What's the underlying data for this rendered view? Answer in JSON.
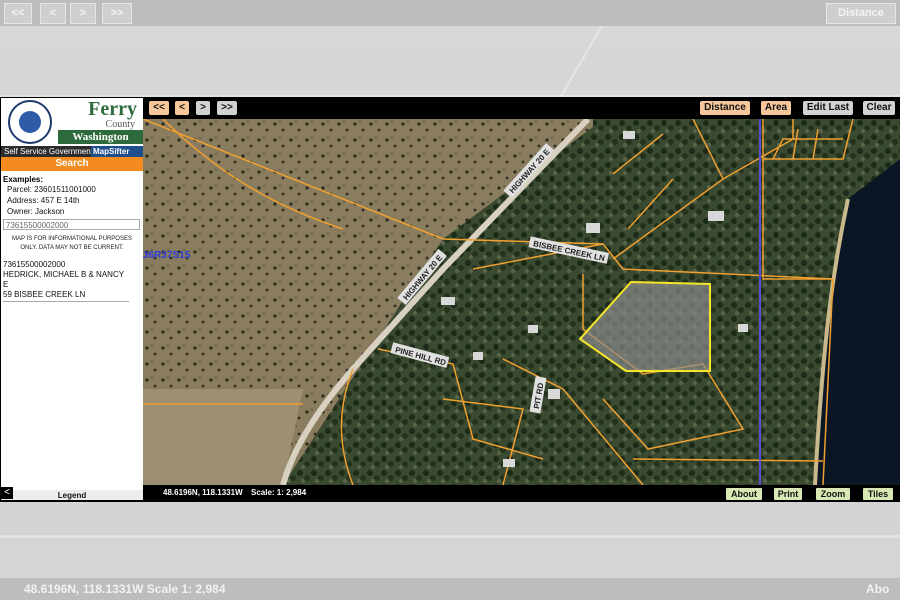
{
  "background": {
    "nav_buttons": [
      "<<",
      "<",
      ">",
      ">>"
    ],
    "distance_label": "Distance",
    "status_text": "48.6196N, 118.1331W    Scale  1: 2,984",
    "about_label": "Abo"
  },
  "sidebar": {
    "county": "Ferry",
    "county_sub": "County",
    "state": "Washington",
    "seal_text": "FERRY COUNTY",
    "brand_left": "Self Service Government",
    "brand_right": "MapSifter",
    "search_label": "Search",
    "examples_title": "Examples:",
    "examples": [
      "Parcel: 23601511001000",
      "Address: 457 E 14th",
      "Owner: Jackson"
    ],
    "search_value": "73615500002000",
    "disclaimer": "MAP IS FOR INFORMATIONAL PURPOSES ONLY. DATA MAY NOT BE CURRENT.",
    "result": {
      "parcel": "73615500002000",
      "owner": "HEDRICK, MICHAEL B & NANCY E",
      "address": "59 BISBEE CREEK LN"
    },
    "legend_label": "Legend",
    "collapse_icon": "<"
  },
  "toolbar": {
    "first_label": "<<",
    "prev_label": "<",
    "next_label": ">",
    "last_label": ">>",
    "distance_label": "Distance",
    "area_label": "Area",
    "edit_last_label": "Edit Last",
    "clear_label": "Clear"
  },
  "map": {
    "section_label": "36R37S15",
    "road_labels": [
      "HIGHWAY 20 E",
      "HIGHWAY 20 E",
      "BISBEE CREEK LN",
      "PINE HILL RD",
      "PIT RD"
    ],
    "parcel_line_color": "#f0a030",
    "highlight_color": "#f5e52a",
    "section_line_color": "#5a4fd0"
  },
  "statusbar": {
    "coords": "48.6196N, 118.1331W",
    "scale": "Scale: 1: 2,984",
    "about_label": "About",
    "print_label": "Print",
    "zoom_label": "Zoom",
    "tiles_label": "Tiles"
  }
}
